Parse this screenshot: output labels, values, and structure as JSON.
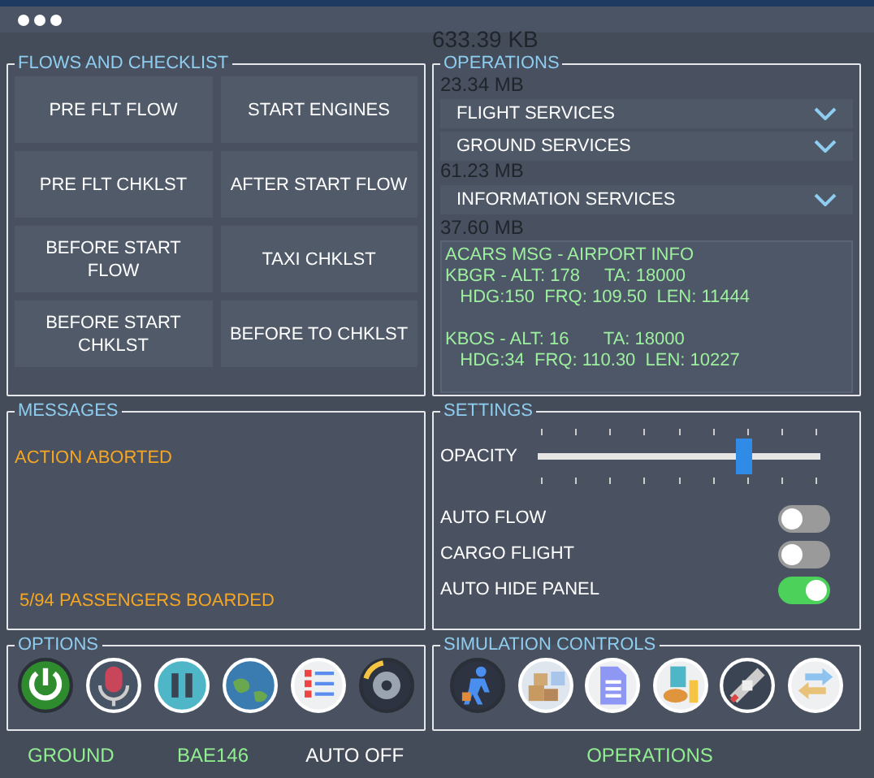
{
  "background_texts": [
    "633.39 KB",
    "23.34 MB",
    "61.23 MB",
    "37.60 MB"
  ],
  "flows": {
    "title": "FLOWS AND CHECKLIST",
    "buttons": [
      "PRE FLT FLOW",
      "START ENGINES",
      "PRE FLT CHKLST",
      "AFTER START FLOW",
      "BEFORE START FLOW",
      "TAXI CHKLST",
      "BEFORE START CHKLST",
      "BEFORE TO CHKLST"
    ]
  },
  "operations": {
    "title": "OPERATIONS",
    "menus": [
      {
        "label": "FLIGHT SERVICES",
        "expanded": false
      },
      {
        "label": "GROUND SERVICES",
        "expanded": false
      },
      {
        "label": "INFORMATION SERVICES",
        "expanded": false
      }
    ],
    "acars": {
      "title": "ACARS MSG - AIRPORT INFO",
      "blocks": [
        [
          "KBGR - ALT: 178     TA: 18000",
          "   HDG:150  FRQ: 109.50  LEN: 11444"
        ],
        [
          "KBOS - ALT: 16       TA: 18000",
          "   HDG:34  FRQ: 110.30  LEN: 10227"
        ]
      ]
    }
  },
  "messages": {
    "title": "MESSAGES",
    "top": "ACTION ABORTED",
    "bottom": "5/94 PASSENGERS BOARDED"
  },
  "settings": {
    "title": "SETTINGS",
    "opacity": {
      "label": "OPACITY",
      "level": 0.73
    },
    "toggles": [
      {
        "label": "AUTO FLOW",
        "on": false
      },
      {
        "label": "CARGO FLIGHT",
        "on": false
      },
      {
        "label": "AUTO HIDE PANEL",
        "on": true
      }
    ]
  },
  "options": {
    "title": "OPTIONS",
    "icons": [
      {
        "kind": "power"
      },
      {
        "kind": "microphone"
      },
      {
        "kind": "pause"
      },
      {
        "kind": "globe"
      },
      {
        "kind": "checklist"
      },
      {
        "kind": "gear"
      }
    ]
  },
  "simulation": {
    "title": "SIMULATION CONTROLS",
    "icons": [
      {
        "kind": "walker"
      },
      {
        "kind": "boxes"
      },
      {
        "kind": "document"
      },
      {
        "kind": "food"
      },
      {
        "kind": "seatbelt"
      },
      {
        "kind": "arrows"
      }
    ]
  },
  "status": [
    {
      "text": "GROUND",
      "color": "#90ee90"
    },
    {
      "text": "BAE146",
      "color": "#90ee90"
    },
    {
      "text": "AUTO OFF",
      "color": "#ffffff"
    },
    {
      "text": "OPERATIONS",
      "color": "#90ee90"
    }
  ]
}
